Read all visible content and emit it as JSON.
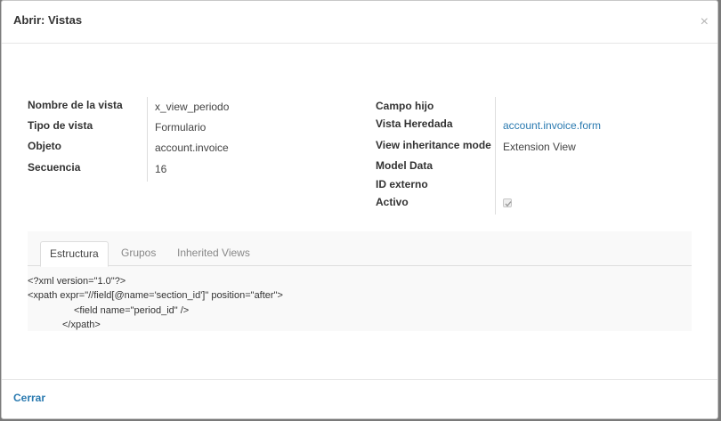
{
  "dialog": {
    "title": "Abrir: Vistas",
    "close_glyph": "×"
  },
  "left_fields": [
    {
      "label": "Nombre de la vista",
      "value": "x_view_periodo"
    },
    {
      "label": "Tipo de vista",
      "value": "Formulario"
    },
    {
      "label": "Objeto",
      "value": "account.invoice"
    },
    {
      "label": "Secuencia",
      "value": "16"
    }
  ],
  "right_fields": [
    {
      "label": "Campo hijo",
      "value": ""
    },
    {
      "label": "Vista Heredada",
      "value": "account.invoice.form"
    },
    {
      "label": "View inheritance mode",
      "value": "Extension View"
    },
    {
      "label": "Model Data",
      "value": ""
    },
    {
      "label": "ID externo",
      "value": ""
    },
    {
      "label": "Activo",
      "value": ""
    }
  ],
  "active_checked": true,
  "tabs": [
    {
      "label": "Estructura",
      "active": true
    },
    {
      "label": "Grupos",
      "active": false
    },
    {
      "label": "Inherited Views",
      "active": false
    }
  ],
  "arch_lines": [
    "<?xml version=\"1.0\"?>",
    "<xpath expr=\"//field[@name='section_id']\" position=\"after\">",
    "<field name=\"period_id\" />",
    "</xpath>"
  ],
  "footer": {
    "close_label": "Cerrar"
  },
  "colors": {
    "link": "#2a7ab0",
    "backdrop": "#7a7a7a"
  }
}
